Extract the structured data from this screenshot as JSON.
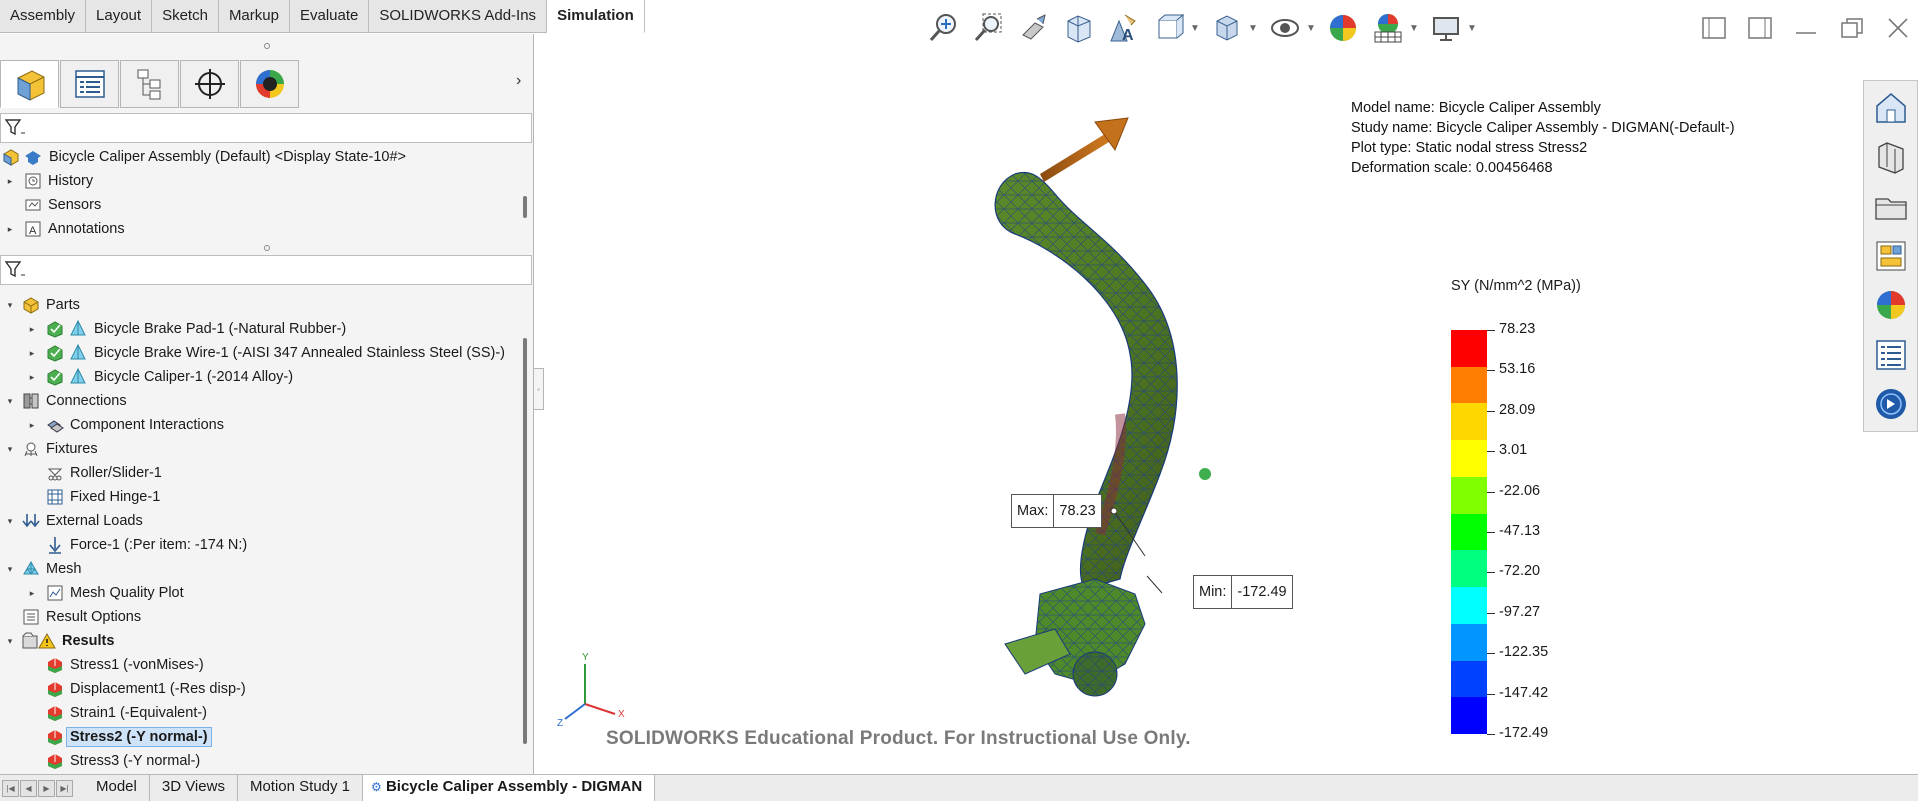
{
  "tabs": [
    "Assembly",
    "Layout",
    "Sketch",
    "Markup",
    "Evaluate",
    "SOLIDWORKS Add-Ins",
    "Simulation"
  ],
  "active_tab": "Simulation",
  "hud_icons": [
    "zoom-to-fit-icon",
    "zoom-to-area-icon",
    "previous-view-icon",
    "section-view-icon",
    "dynamic-annotation-icon",
    "view-orientation-icon",
    "display-style-icon",
    "hide-show-items-icon",
    "edit-appearance-icon",
    "apply-scene-icon",
    "view-settings-icon"
  ],
  "feature_tree": {
    "top": [
      {
        "label": "Bicycle Caliper Assembly (Default) <Display State-10#>"
      },
      {
        "label": "History"
      },
      {
        "label": "Sensors"
      },
      {
        "label": "Annotations"
      }
    ],
    "study": [
      {
        "label": "Parts",
        "bold": false
      },
      {
        "label": "Bicycle Brake Pad-1 (-Natural Rubber-)"
      },
      {
        "label": "Bicycle Brake Wire-1 (-AISI 347 Annealed Stainless Steel (SS)-)"
      },
      {
        "label": "Bicycle Caliper-1 (-2014 Alloy-)"
      },
      {
        "label": "Connections"
      },
      {
        "label": "Component Interactions"
      },
      {
        "label": "Fixtures"
      },
      {
        "label": "Roller/Slider-1"
      },
      {
        "label": "Fixed Hinge-1"
      },
      {
        "label": "External Loads"
      },
      {
        "label": "Force-1 (:Per item: -174 N:)"
      },
      {
        "label": "Mesh"
      },
      {
        "label": "Mesh Quality Plot"
      },
      {
        "label": "Result Options"
      },
      {
        "label": "Results"
      },
      {
        "label": "Stress1 (-vonMises-)"
      },
      {
        "label": "Displacement1 (-Res disp-)"
      },
      {
        "label": "Strain1 (-Equivalent-)"
      },
      {
        "label": "Stress2 (-Y normal-)"
      },
      {
        "label": "Stress3 (-Y normal-)"
      }
    ]
  },
  "bottom_tabs": [
    "Model",
    "3D Views",
    "Motion Study 1",
    "Bicycle Caliper Assembly - DIGMAN"
  ],
  "model_info": {
    "model_name": "Model name: Bicycle Caliper Assembly",
    "study_name": "Study name: Bicycle Caliper Assembly - DIGMAN(-Default-)",
    "plot_type": "Plot type: Static nodal stress Stress2",
    "deformation_scale": "Deformation scale: 0.00456468"
  },
  "legend": {
    "title": "SY (N/mm^2 (MPa))",
    "labels": [
      "78.23",
      "53.16",
      "28.09",
      "3.01",
      "-22.06",
      "-47.13",
      "-72.20",
      "-97.27",
      "-122.35",
      "-147.42",
      "-172.49"
    ],
    "colors": [
      "#ff0000",
      "#ff7d00",
      "#ffd700",
      "#ffff00",
      "#7fff00",
      "#00ff00",
      "#00ff80",
      "#00ffff",
      "#0095ff",
      "#0040ff",
      "#0000ff"
    ]
  },
  "probes": {
    "max_label": "Max:",
    "max_value": "78.23",
    "min_label": "Min:",
    "min_value": "-172.49"
  },
  "watermark": "SOLIDWORKS Educational Product. For Instructional Use Only.",
  "task_pane_icons": [
    "solidworks-resources-icon",
    "design-library-icon",
    "file-explorer-icon",
    "view-palette-icon",
    "appearances-icon",
    "custom-properties-icon",
    "solidworks-forum-icon"
  ]
}
